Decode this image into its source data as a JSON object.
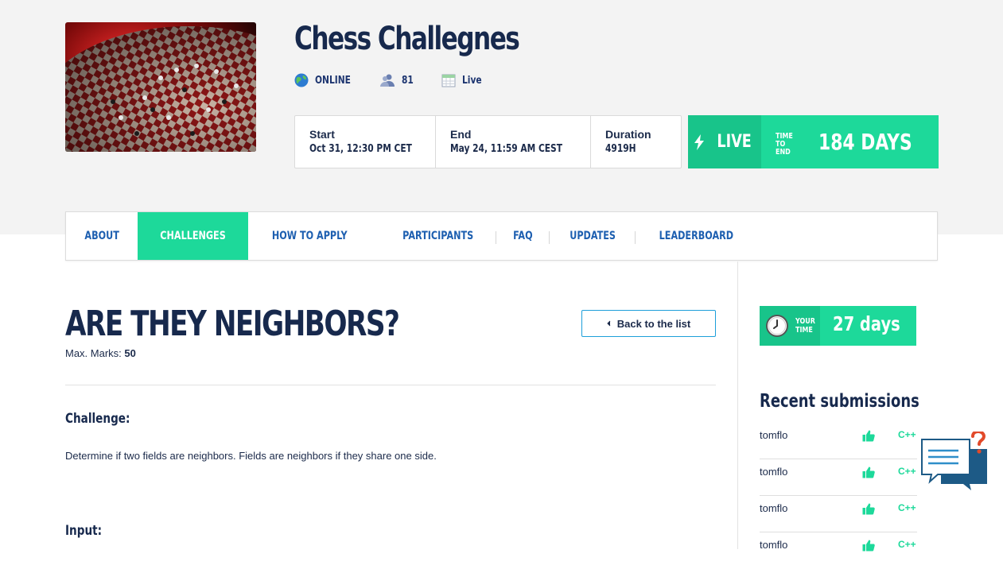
{
  "event": {
    "title": "Chess Challegnes",
    "mode": "ONLINE",
    "participants_count": "81",
    "status": "Live"
  },
  "schedule": {
    "start_label": "Start",
    "start_value": "Oct 31, 12:30 PM CET",
    "end_label": "End",
    "end_value": "May 24, 11:59 AM CEST",
    "duration_label": "Duration",
    "duration_value": "4919H"
  },
  "live_banner": {
    "label": "LIVE",
    "time_to_end_line1": "TIME",
    "time_to_end_line2": "TO END",
    "value": "184 DAYS"
  },
  "tabs": [
    {
      "label": "ABOUT",
      "active": false
    },
    {
      "label": "CHALLENGES",
      "active": true
    },
    {
      "label": "HOW TO APPLY",
      "active": false
    },
    {
      "label": "PARTICIPANTS",
      "active": false
    },
    {
      "label": "FAQ",
      "active": false
    },
    {
      "label": "UPDATES",
      "active": false
    },
    {
      "label": "LEADERBOARD",
      "active": false
    }
  ],
  "challenge": {
    "title": "ARE THEY NEIGHBORS?",
    "max_marks_label": "Max. Marks:",
    "max_marks_value": "50",
    "back_button": "Back to the list",
    "section_challenge": "Challenge:",
    "description": "Determine if two fields are neighbors. Fields are neighbors if they share one side.",
    "section_input": "Input:"
  },
  "your_time": {
    "line1": "YOUR",
    "line2": "TIME",
    "value": "27 days"
  },
  "recent_submissions": {
    "title": "Recent submissions",
    "items": [
      {
        "user": "tomflo",
        "lang": "C++"
      },
      {
        "user": "tomflo",
        "lang": "C++"
      },
      {
        "user": "tomflo",
        "lang": "C++"
      },
      {
        "user": "tomflo",
        "lang": "C++"
      }
    ]
  },
  "colors": {
    "accent_green": "#1dd99a",
    "navy": "#17294d",
    "link_blue": "#1d5fb0"
  },
  "icons": [
    "globe-icon",
    "users-icon",
    "calendar-icon",
    "bolt-icon",
    "clock-icon",
    "chevron-left-icon",
    "thumbs-up-icon",
    "help-chat-icon"
  ]
}
